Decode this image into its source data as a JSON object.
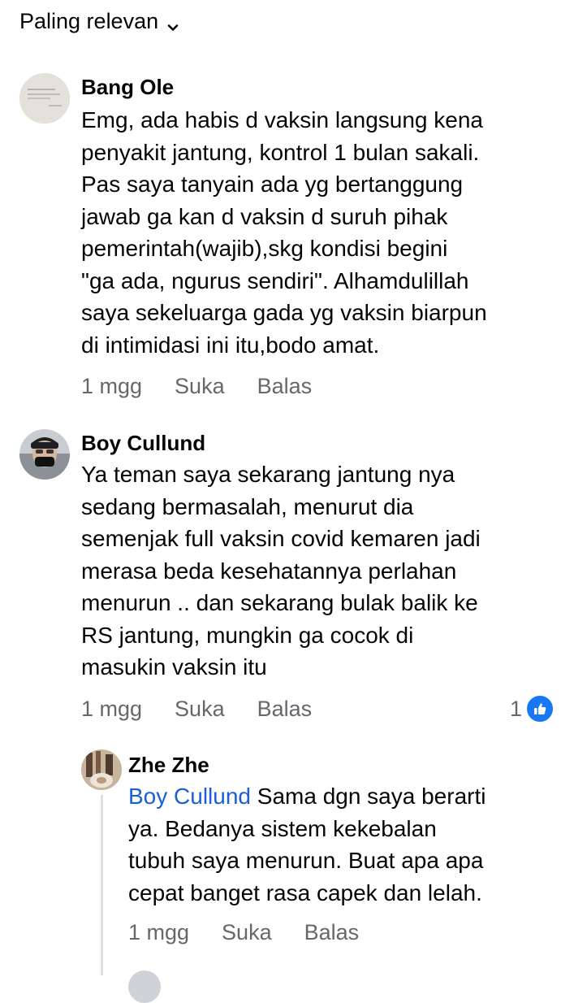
{
  "sort": {
    "label": "Paling relevan",
    "icon": "chevron-down-icon"
  },
  "comments": [
    {
      "author": "Bang Ole",
      "text": "Emg, ada habis d vaksin langsung kena\npenyakit jantung, kontrol 1 bulan sakali.\nPas saya tanyain ada yg bertanggung\njawab ga kan d vaksin d suruh pihak\npemerintah(wajib),skg kondisi begini\n\"ga ada, ngurus sendiri\". Alhamdulillah\nsaya sekeluarga gada yg vaksin biarpun\ndi intimidasi ini itu,bodo amat.",
      "time": "1 mgg",
      "like_label": "Suka",
      "reply_label": "Balas"
    },
    {
      "author": "Boy Cullund",
      "text": "Ya teman saya sekarang jantung nya\nsedang bermasalah, menurut dia\nsemenjak full vaksin covid kemaren jadi\nmerasa beda kesehatannya perlahan\nmenurun .. dan sekarang bulak balik ke\nRS jantung, mungkin ga cocok di\nmasukin vaksin itu",
      "time": "1 mgg",
      "like_label": "Suka",
      "reply_label": "Balas",
      "reaction_count": "1",
      "reaction_icon": "like-thumb-icon"
    }
  ],
  "reply": {
    "author": "Zhe Zhe",
    "mention": "Boy Cullund",
    "text_first": " Sama dgn saya berarti",
    "text_rest": "ya. Bedanya sistem kekebalan\ntubuh saya menurun. Buat apa apa\ncepat banget rasa capek dan lelah.",
    "time": "1 mgg",
    "like_label": "Suka",
    "reply_label": "Balas"
  },
  "colors": {
    "link_blue": "#1b5fd6",
    "meta_gray": "#65676b",
    "like_blue": "#1877f2"
  }
}
